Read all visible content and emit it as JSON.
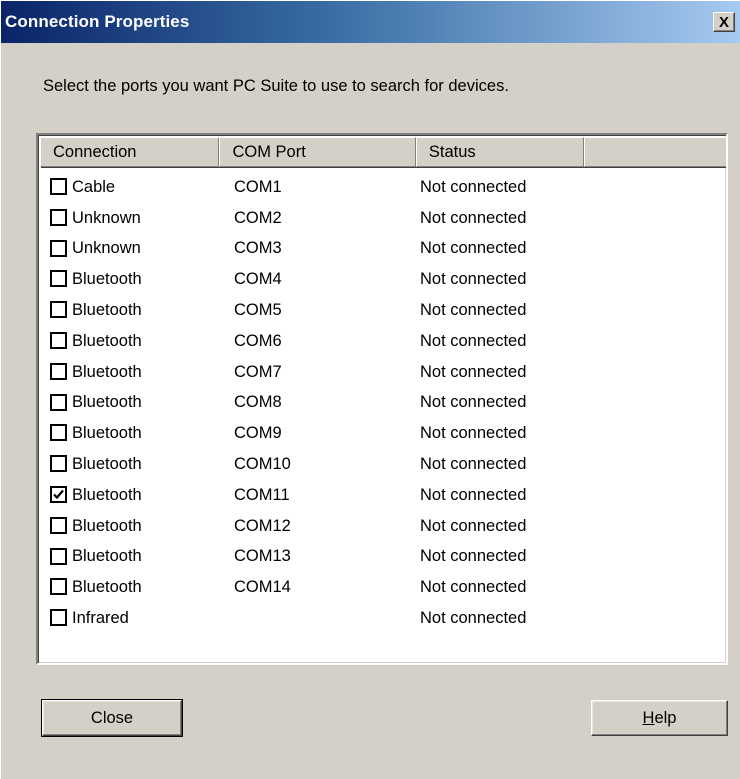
{
  "window": {
    "title": "Connection Properties",
    "close_glyph": "X"
  },
  "instruction": "Select the ports you want PC Suite to use to search for devices.",
  "table": {
    "columns": [
      "Connection",
      "COM Port",
      "Status",
      ""
    ],
    "rows": [
      {
        "connection": "Cable",
        "port": "COM1",
        "status": "Not connected",
        "checked": false
      },
      {
        "connection": "Unknown",
        "port": "COM2",
        "status": "Not connected",
        "checked": false
      },
      {
        "connection": "Unknown",
        "port": "COM3",
        "status": "Not connected",
        "checked": false
      },
      {
        "connection": "Bluetooth",
        "port": "COM4",
        "status": "Not connected",
        "checked": false
      },
      {
        "connection": "Bluetooth",
        "port": "COM5",
        "status": "Not connected",
        "checked": false
      },
      {
        "connection": "Bluetooth",
        "port": "COM6",
        "status": "Not connected",
        "checked": false
      },
      {
        "connection": "Bluetooth",
        "port": "COM7",
        "status": "Not connected",
        "checked": false
      },
      {
        "connection": "Bluetooth",
        "port": "COM8",
        "status": "Not connected",
        "checked": false
      },
      {
        "connection": "Bluetooth",
        "port": "COM9",
        "status": "Not connected",
        "checked": false
      },
      {
        "connection": "Bluetooth",
        "port": "COM10",
        "status": "Not connected",
        "checked": false
      },
      {
        "connection": "Bluetooth",
        "port": "COM11",
        "status": "Not connected",
        "checked": true
      },
      {
        "connection": "Bluetooth",
        "port": "COM12",
        "status": "Not connected",
        "checked": false
      },
      {
        "connection": "Bluetooth",
        "port": "COM13",
        "status": "Not connected",
        "checked": false
      },
      {
        "connection": "Bluetooth",
        "port": "COM14",
        "status": "Not connected",
        "checked": false
      },
      {
        "connection": "Infrared",
        "port": "",
        "status": "Not connected",
        "checked": false
      }
    ]
  },
  "buttons": {
    "close_label": "Close",
    "help_label": "Help",
    "help_mnemonic": "H"
  },
  "colors": {
    "titlebar_start": "#0a246a",
    "titlebar_end": "#a6caf0",
    "dialog_face": "#d4d0c8"
  }
}
